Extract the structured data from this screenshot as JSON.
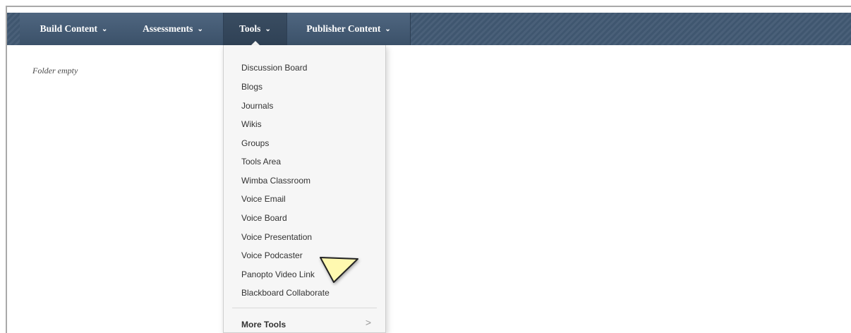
{
  "nav": {
    "items": [
      {
        "label": "Build Content",
        "chevron": "⌄"
      },
      {
        "label": "Assessments",
        "chevron": "⌄"
      },
      {
        "label": "Tools",
        "chevron": "⌄",
        "active": true
      },
      {
        "label": "Publisher Content",
        "chevron": "⌄"
      }
    ]
  },
  "content": {
    "empty_message": "Folder empty"
  },
  "tools_menu": {
    "items": [
      "Discussion Board",
      "Blogs",
      "Journals",
      "Wikis",
      "Groups",
      "Tools Area",
      "Wimba Classroom",
      "Voice Email",
      "Voice Board",
      "Voice Presentation",
      "Voice Podcaster",
      "Panopto Video Link",
      "Blackboard Collaborate"
    ],
    "more_label": "More Tools",
    "more_chevron": ">"
  },
  "colors": {
    "navbar": "#3f566f",
    "menu_bg": "#f6f6f6",
    "pointer_fill": "#fff9b0",
    "pointer_stroke": "#222222"
  },
  "icons": {
    "pointer": "cursor-arrow-icon"
  }
}
